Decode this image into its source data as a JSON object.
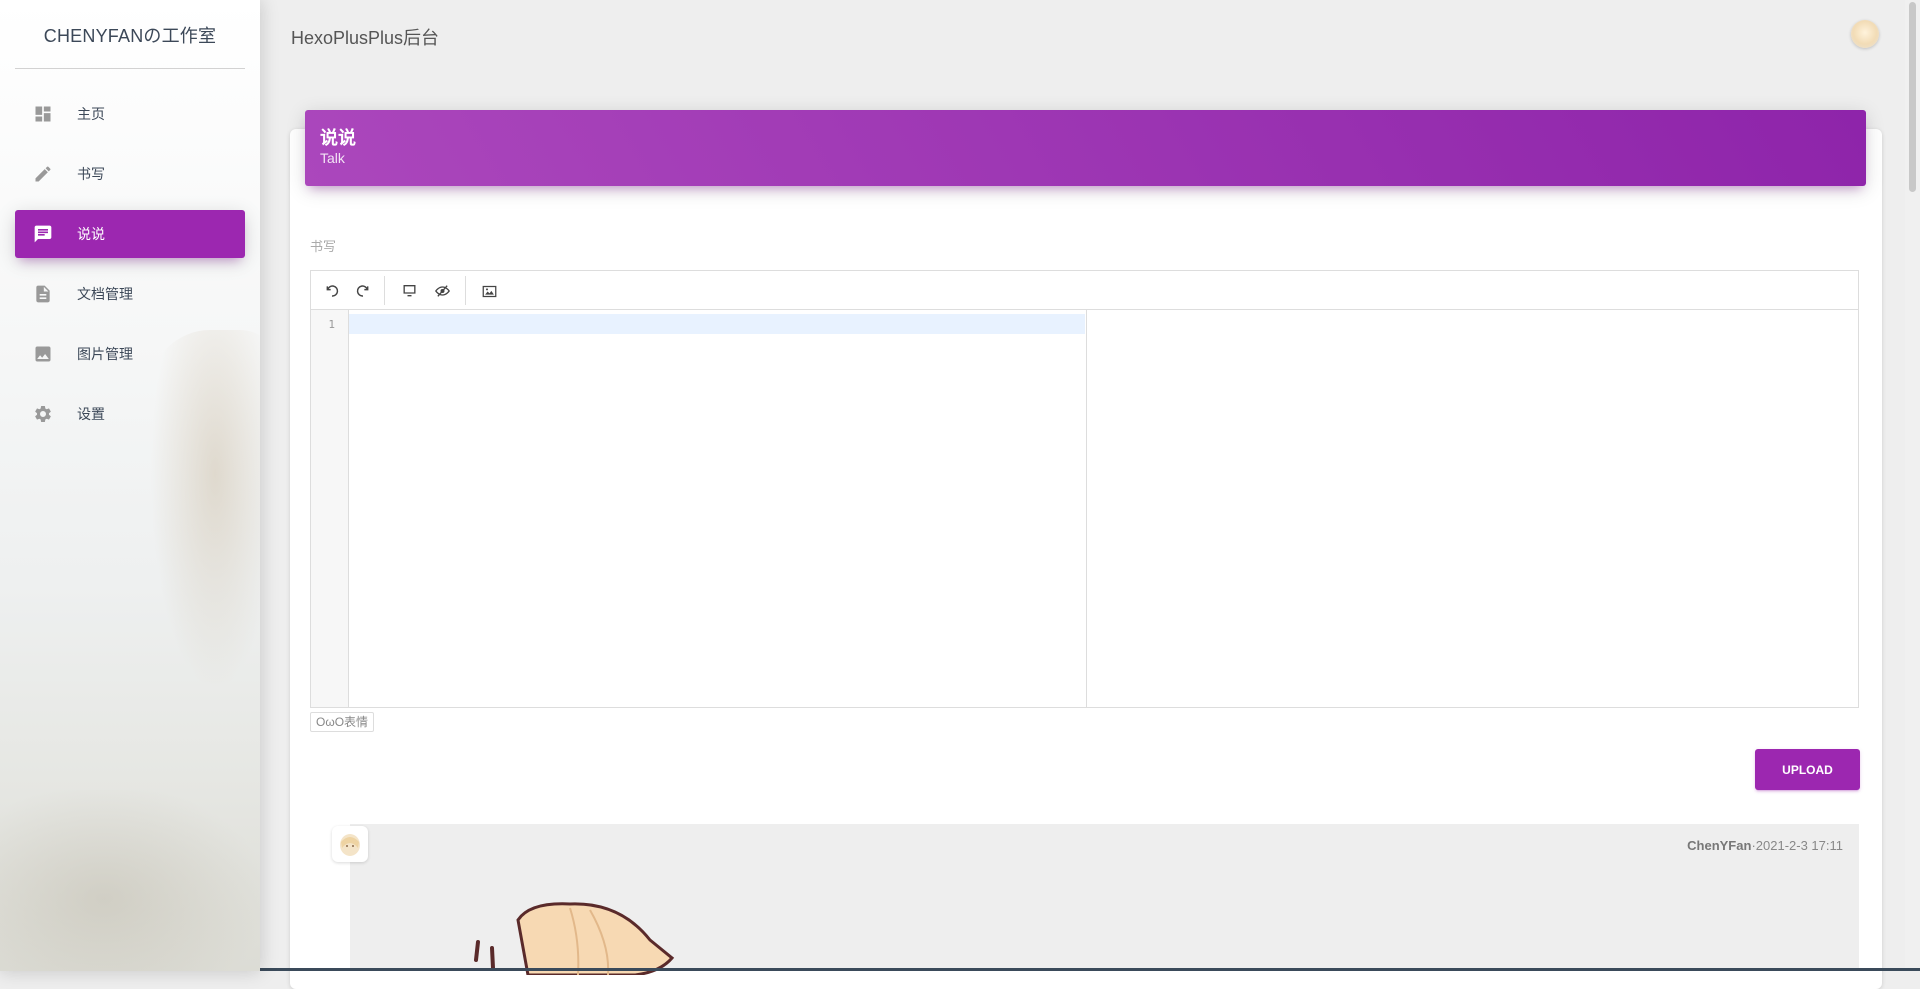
{
  "sidebar": {
    "brand": "CHENYFANの工作室",
    "items": [
      {
        "label": "主页",
        "icon": "dashboard-icon",
        "active": false
      },
      {
        "label": "书写",
        "icon": "pencil-icon",
        "active": false
      },
      {
        "label": "说说",
        "icon": "chat-icon",
        "active": true
      },
      {
        "label": "文档管理",
        "icon": "document-icon",
        "active": false
      },
      {
        "label": "图片管理",
        "icon": "image-icon",
        "active": false
      },
      {
        "label": "设置",
        "icon": "gear-icon",
        "active": false
      }
    ]
  },
  "topbar": {
    "title": "HexoPlusPlus后台",
    "avatar_icon": "user-avatar-icon"
  },
  "card": {
    "title": "说说",
    "subtitle": "Talk",
    "field_label": "书写"
  },
  "editor": {
    "toolbar": [
      "undo-icon",
      "redo-icon",
      "monitor-icon",
      "hide-preview-icon",
      "image-icon"
    ],
    "line_numbers": [
      "1"
    ],
    "content": ""
  },
  "owo_button": "OωO表情",
  "upload_button": "UPLOAD",
  "talk": {
    "author": "ChenYFan",
    "separator": "·",
    "date": "2021-2-3 17:11"
  },
  "colors": {
    "primary": "#9c27b0",
    "header_gradient_start": "#ab47bc",
    "header_gradient_end": "#8e24aa",
    "background": "#eeeeee",
    "text": "#3c4858"
  }
}
